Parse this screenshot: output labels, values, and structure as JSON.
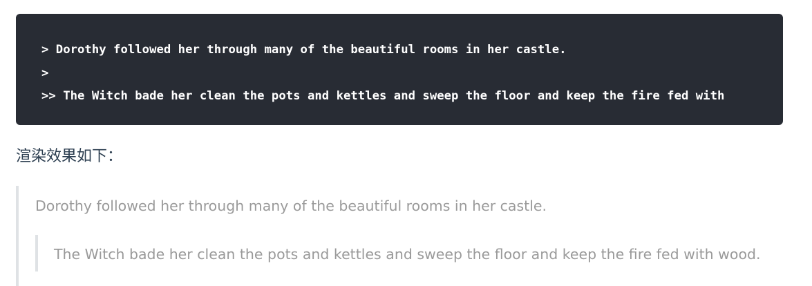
{
  "code_block": {
    "lines": [
      "> Dorothy followed her through many of the beautiful rooms in her castle.",
      ">",
      ">> The Witch bade her clean the pots and kettles and sweep the floor and keep the fire fed with"
    ]
  },
  "caption": "渲染效果如下：",
  "rendered": {
    "outer_quote": "Dorothy followed her through many of the beautiful rooms in her castle.",
    "inner_quote": "The Witch bade her clean the pots and kettles and sweep the floor and keep the fire fed with wood."
  }
}
